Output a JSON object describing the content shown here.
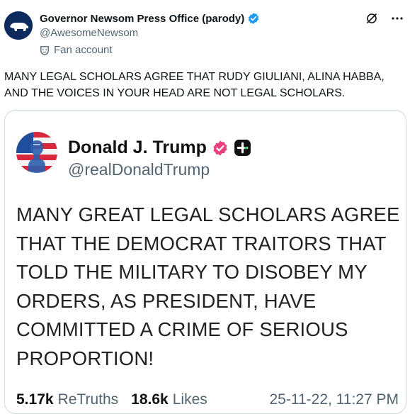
{
  "header": {
    "display_name": "Governor Newsom Press Office (parody)",
    "handle": "@AwesomeNewsom",
    "fan_label": "Fan account",
    "icons": [
      "verified-badge-icon",
      "grok-icon",
      "more-icon",
      "mask-icon"
    ]
  },
  "tweet": {
    "text": "MANY LEGAL SCHOLARS AGREE THAT RUDY GIULIANI,  ALINA HABBA, AND THE VOICES IN YOUR HEAD ARE NOT LEGAL SCHOLARS."
  },
  "quoted_post": {
    "name": "Donald J. Trump",
    "handle": "@realDonaldTrump",
    "text": "MANY GREAT LEGAL SCHOLARS AGREE THAT THE DEMOCRAT TRAITORS THAT TOLD THE MILITARY TO DISOBEY MY ORDERS, AS PRESIDENT, HAVE COMMITTED A CRIME OF SERIOUS PROPORTION!",
    "retruths_count": "5.17k",
    "retruths_label": "ReTruths",
    "likes_count": "18.6k",
    "likes_label": "Likes",
    "timestamp": "25-11-22, 11:27 PM",
    "icons": [
      "pink-verified-icon",
      "plus-badge-icon"
    ]
  },
  "colors": {
    "verified_blue": "#1d9bf0",
    "truth_pink": "#e8407b",
    "muted": "#536471"
  }
}
